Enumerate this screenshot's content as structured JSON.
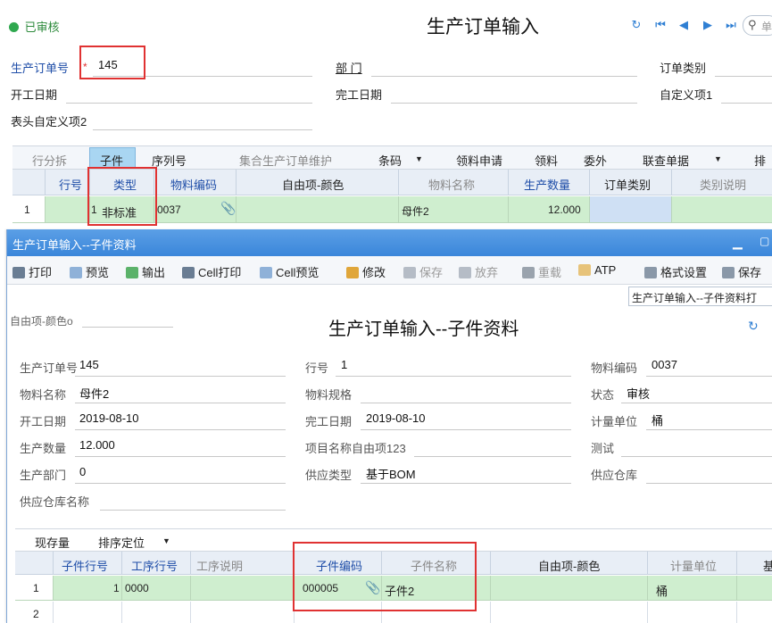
{
  "main": {
    "status": "已审核",
    "title": "生产订单输入",
    "search_placeholder": "单",
    "fields": {
      "order_no_label": "生产订单号",
      "order_no_required": "*",
      "order_no_value": "145",
      "dept_label": "部 门",
      "order_type_label": "订单类别",
      "start_date_label": "开工日期",
      "end_date_label": "完工日期",
      "custom1_label": "自定义项1",
      "header_custom2_label": "表头自定义项2"
    },
    "toolbar": [
      "行分拆",
      "子件",
      "序列号",
      "集合生产订单维护",
      "条码",
      "领料申请",
      "领料",
      "委外",
      "联查单据",
      "排"
    ],
    "grid": {
      "headers": [
        "行号",
        "类型",
        "物料编码",
        "自由项-颜色",
        "物料名称",
        "生产数量",
        "订单类别",
        "类别说明"
      ],
      "row_index": "1",
      "row": {
        "line": "1",
        "type": "非标准",
        "code": "0037",
        "name": "母件2",
        "qty": "12.000"
      }
    }
  },
  "child": {
    "window_title": "生产订单输入--子件资料",
    "toolbar": {
      "print": "打印",
      "preview": "预览",
      "export": "输出",
      "cell_print": "Cell打印",
      "cell_preview": "Cell预览",
      "edit": "修改",
      "save": "保存",
      "abandon": "放弃",
      "refresh": "重载",
      "atp": "ATP",
      "format": "格式设置",
      "save_format": "保存"
    },
    "format_select": "生产订单输入--子件资料打",
    "side_label": "自由项-颜色o",
    "title": "生产订单输入--子件资料",
    "form": {
      "order_no_label": "生产订单号",
      "order_no": "145",
      "line_label": "行号",
      "line": "1",
      "item_code_label": "物料编码",
      "item_code": "0037",
      "item_name_label": "物料名称",
      "item_name": "母件2",
      "spec_label": "物料规格",
      "status_label": "状态",
      "status": "审核",
      "start_date_label": "开工日期",
      "start_date": "2019-08-10",
      "end_date_label": "完工日期",
      "end_date": "2019-08-10",
      "unit_label": "计量单位",
      "unit": "桶",
      "qty_label": "生产数量",
      "qty": "12.000",
      "project_label": "项目名称自由项123",
      "test_label": "测试",
      "dept_label": "生产部门",
      "dept": "0",
      "supply_type_label": "供应类型",
      "supply_type": "基于BOM",
      "warehouse_label": "供应仓库",
      "warehouse_name_label": "供应仓库名称"
    },
    "grid_tabs": {
      "stock": "现存量",
      "sort": "排序定位"
    },
    "grid": {
      "headers": [
        "子件行号",
        "工序行号",
        "工序说明",
        "子件编码",
        "子件名称",
        "自由项-颜色",
        "计量单位",
        "基"
      ],
      "rows": [
        {
          "idx": "1",
          "line": "1",
          "op": "0000",
          "code": "000005",
          "name": "子件2",
          "unit": "桶"
        },
        {
          "idx": "2"
        }
      ]
    }
  }
}
